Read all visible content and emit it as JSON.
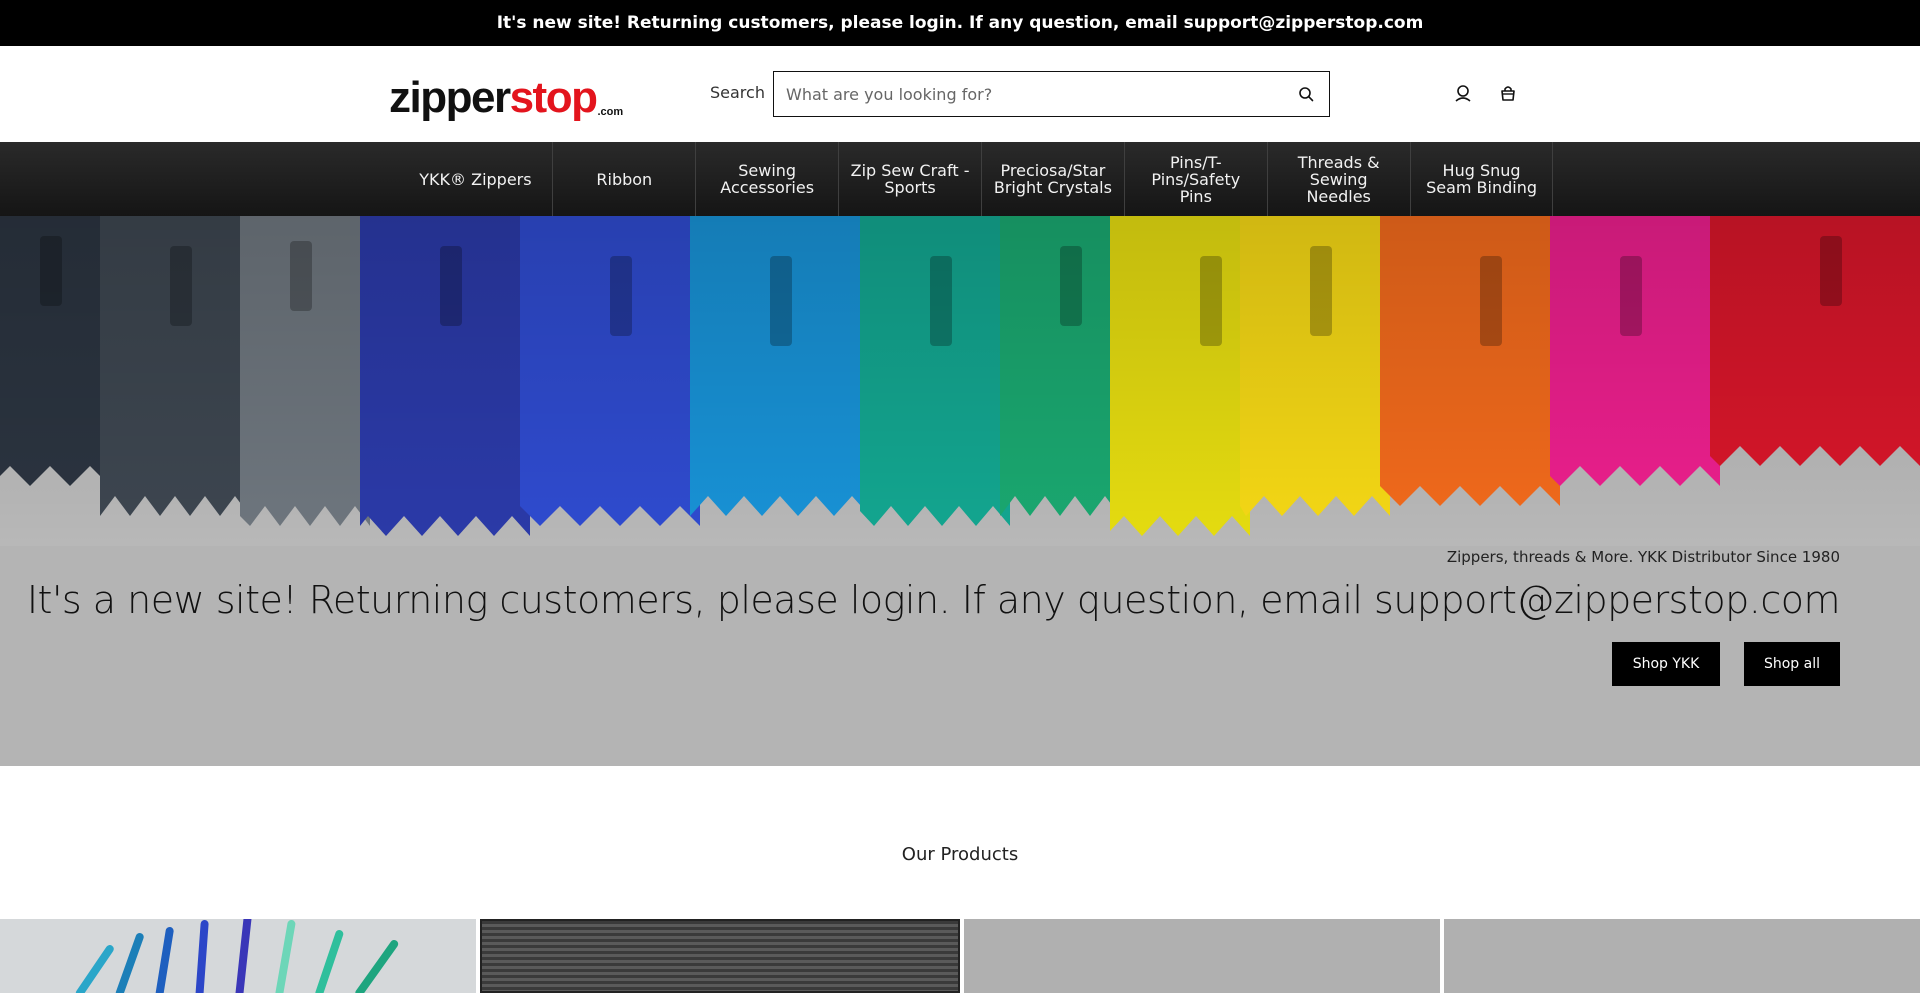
{
  "announcement": "It's new site! Returning customers, please login. If any question, email support@zipperstop.com",
  "header": {
    "logo": {
      "part1": "zipper",
      "part2": "stop",
      "suffix": ".com"
    },
    "search_label": "Search",
    "search_placeholder": "What are you looking for?"
  },
  "nav": [
    "YKK® Zippers",
    "Ribbon",
    "Sewing Accessories",
    "Zip Sew Craft - Sports",
    "Preciosa/Star Bright Crystals",
    "Pins/T-Pins/Safety Pins",
    "Threads & Sewing Needles",
    "Hug Snug Seam Binding"
  ],
  "hero": {
    "subtitle": "Zippers, threads & More. YKK Distributor Since 1980",
    "title": "It's a new site! Returning customers, please login. If any question, email support@zipperstop.com",
    "buttons": {
      "shop_ykk": "Shop YKK",
      "shop_all": "Shop all"
    }
  },
  "products": {
    "heading": "Our Products"
  },
  "icons": {
    "search": "search-icon",
    "account": "user-icon",
    "cart": "bag-icon"
  },
  "colors": {
    "brand_red": "#e3141d",
    "announcement_bg": "#000000",
    "nav_bg": "#1f1f1f"
  }
}
